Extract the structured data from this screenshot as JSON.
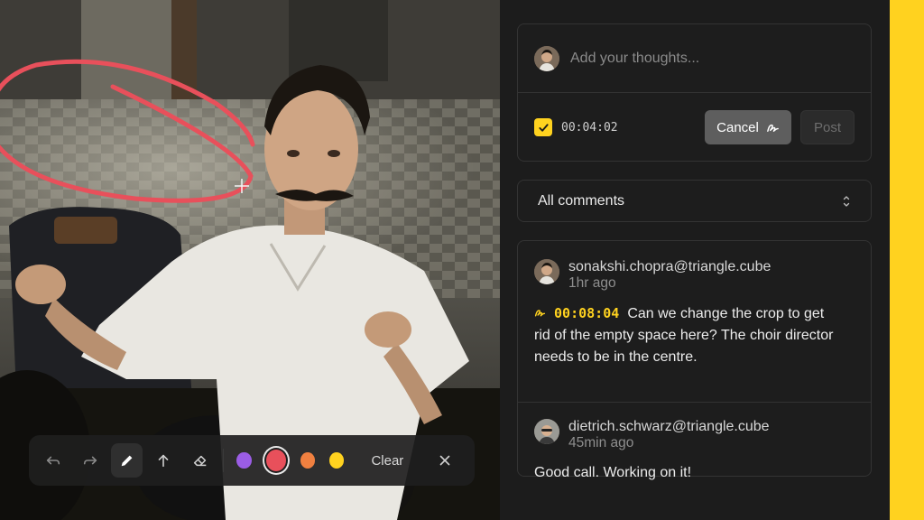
{
  "toolbar": {
    "tools": [
      "undo-icon",
      "redo-icon",
      "pen-icon",
      "arrow-up-icon",
      "eraser-icon"
    ],
    "active_tool": "pen-icon",
    "colors": [
      "#9b5de5",
      "#e8505b",
      "#f08040",
      "#ffd21f"
    ],
    "selected_color": "#e8505b",
    "clear_label": "Clear",
    "close_icon": "close-icon"
  },
  "composer": {
    "placeholder": "Add your thoughts...",
    "timestamp_checked": true,
    "timestamp": "00:04:02",
    "cancel_label": "Cancel",
    "post_label": "Post"
  },
  "filter": {
    "selected": "All comments"
  },
  "comments": [
    {
      "author": "sonakshi.chopra@triangle.cube",
      "time": "1hr ago",
      "timestamp": "00:08:04",
      "text": "Can we change the crop to get rid of the empty space here? The choir director needs to be in the centre."
    },
    {
      "author": "dietrich.schwarz@triangle.cube",
      "time": "45min ago",
      "text": "Good call. Working on it!"
    }
  ],
  "colors": {
    "accent": "#ffd21f",
    "annotation": "#e8505b",
    "panel_bg": "#1c1c1c"
  }
}
